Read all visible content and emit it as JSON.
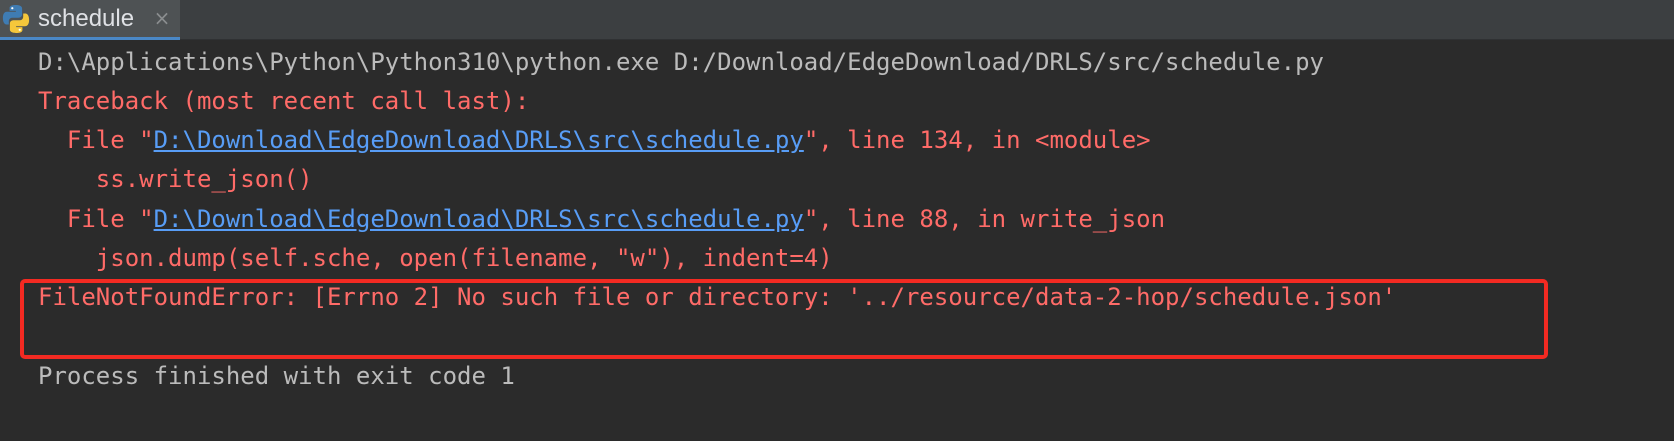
{
  "tab": {
    "title": "schedule",
    "icon": "python-icon",
    "close_symbol": "×"
  },
  "console": {
    "command": "D:\\Applications\\Python\\Python310\\python.exe D:/Download/EdgeDownload/DRLS/src/schedule.py",
    "traceback_header": "Traceback (most recent call last):",
    "frames": [
      {
        "prefix": "  File \"",
        "path": "D:\\Download\\EdgeDownload\\DRLS\\src\\schedule.py",
        "suffix": "\", line 134, in <module>",
        "code": "    ss.write_json()"
      },
      {
        "prefix": "  File \"",
        "path": "D:\\Download\\EdgeDownload\\DRLS\\src\\schedule.py",
        "suffix": "\", line 88, in write_json",
        "code": "    json.dump(self.sche, open(filename, \"w\"), indent=4)"
      }
    ],
    "error": "FileNotFoundError: [Errno 2] No such file or directory: '../resource/data-2-hop/schedule.json'",
    "exit_message": "Process finished with exit code 1"
  },
  "colors": {
    "background": "#2b2b2b",
    "plain_text": "#bbbbbb",
    "error_text": "#ff6b68",
    "link_text": "#589df6",
    "highlight_box": "#f32a22"
  }
}
